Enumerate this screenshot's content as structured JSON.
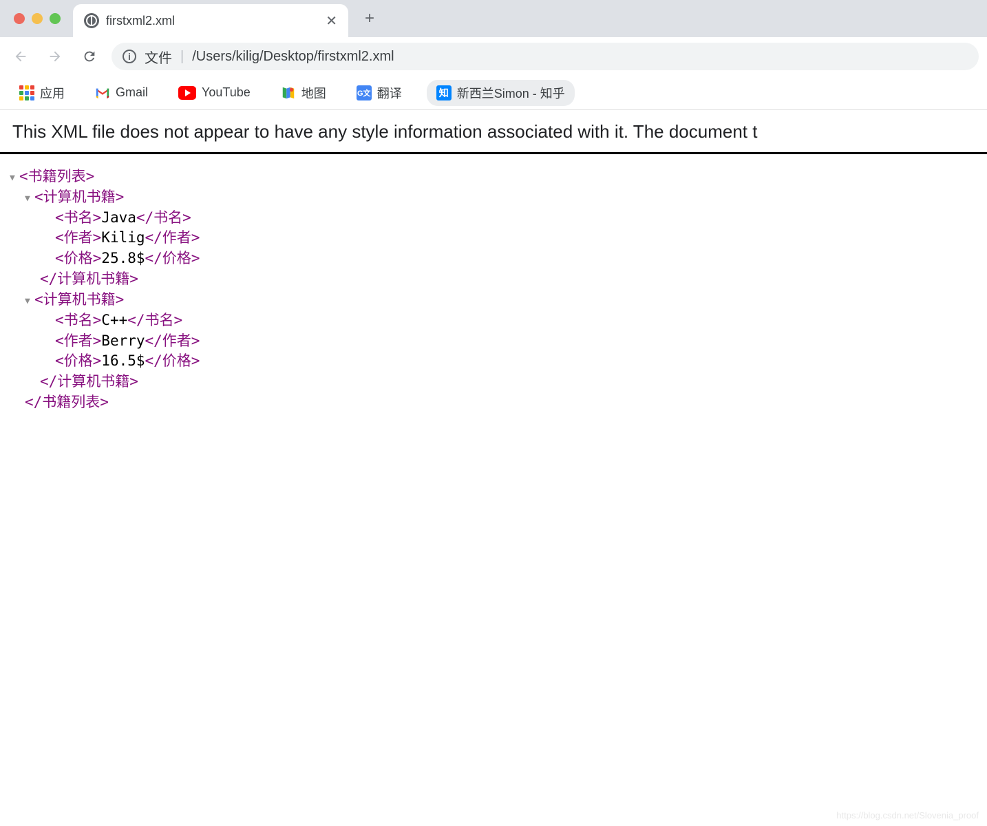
{
  "tab": {
    "title": "firstxml2.xml"
  },
  "omnibox": {
    "prefix": "文件",
    "path": "/Users/kilig/Desktop/firstxml2.xml"
  },
  "bookmarks": {
    "apps": "应用",
    "gmail": "Gmail",
    "youtube": "YouTube",
    "maps": "地图",
    "translate": "翻译",
    "zhihu": "新西兰Simon - 知乎"
  },
  "notice": "This XML file does not appear to have any style information associated with it. The document t",
  "xml": {
    "root_open": "<书籍列表>",
    "root_close": "</书籍列表>",
    "item_open": "<计算机书籍>",
    "item_close": "</计算机书籍>",
    "name_tag_open": "<书名>",
    "name_tag_close": "</书名>",
    "author_tag_open": "<作者>",
    "author_tag_close": "</作者>",
    "price_tag_open": "<价格>",
    "price_tag_close": "</价格>",
    "books": [
      {
        "name": "Java",
        "author": "Kilig",
        "price": "25.8$"
      },
      {
        "name": "C++",
        "author": "Berry",
        "price": "16.5$"
      }
    ]
  },
  "watermark": "https://blog.csdn.net/Slovenia_proof"
}
